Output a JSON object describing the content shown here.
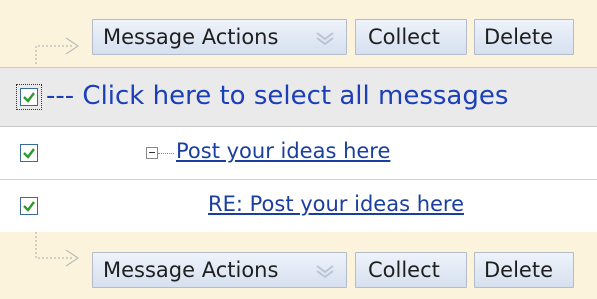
{
  "toolbar_top": {
    "message_actions_label": "Message Actions",
    "collect_label": "Collect",
    "delete_label": "Delete"
  },
  "select_all": {
    "label": "--- Click here to select all messages",
    "checked": true
  },
  "messages": [
    {
      "subject": "Post your ideas here",
      "checked": true,
      "expanded": true
    },
    {
      "subject": "RE: Post your ideas here",
      "checked": true
    }
  ],
  "toolbar_bottom": {
    "message_actions_label": "Message Actions",
    "collect_label": "Collect",
    "delete_label": "Delete"
  },
  "colors": {
    "toolbar_bg": "#fcf3dc",
    "select_all_bg": "#eaeaea",
    "link": "#1a3fa0",
    "select_all_text": "#1a3fb8",
    "checkmark": "#2e9a2e"
  },
  "icons": {
    "checkbox_check": "checkmark-icon",
    "dropdown": "chevron-down-icon",
    "tree": "collapse-icon"
  }
}
